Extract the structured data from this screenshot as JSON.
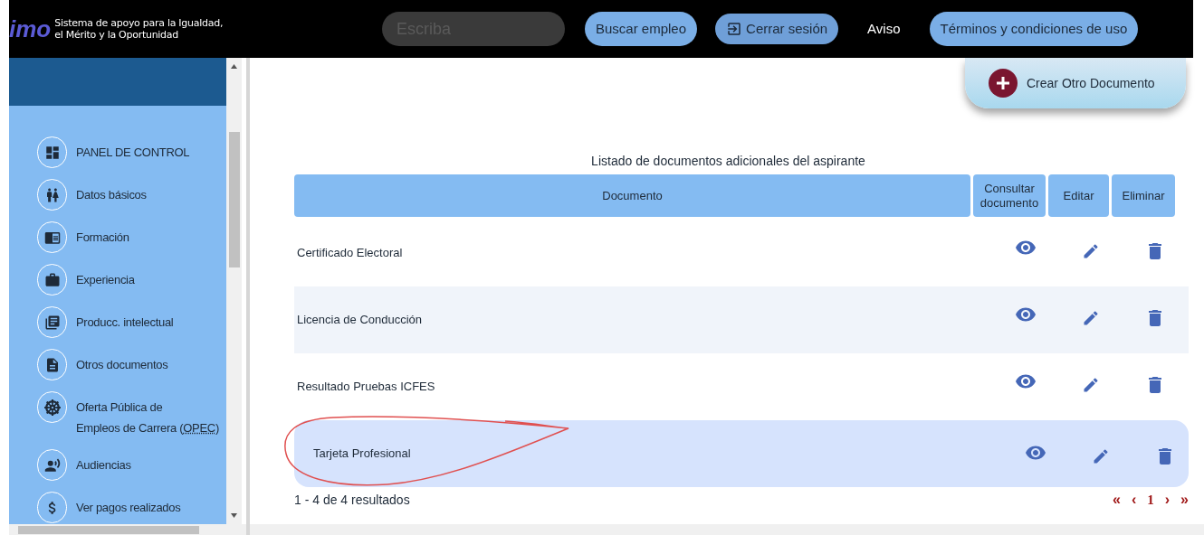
{
  "header": {
    "logo_text": "imo",
    "tagline_1": "Sistema de apoyo para la Igualdad,",
    "tagline_2": "el Mérito y la Oportunidad",
    "search": {
      "placeholder": "Escriba"
    },
    "buttons": [
      {
        "kind": "pill",
        "label": "Buscar empleo"
      },
      {
        "kind": "logout",
        "label": "Cerrar sesión"
      },
      {
        "kind": "link",
        "label": "Aviso"
      },
      {
        "kind": "pill",
        "label": "Términos y condiciones de uso"
      }
    ]
  },
  "sidebar": {
    "items": [
      {
        "label": "PANEL DE CONTROL"
      },
      {
        "label": "Datos básicos"
      },
      {
        "label": "Formación"
      },
      {
        "label": "Experiencia"
      },
      {
        "label": "Producc. intelectual"
      },
      {
        "label": "Otros documentos"
      },
      {
        "label": "Oferta Pública de",
        "label_2": "Empleos de Carrera (",
        "abbr": "OPEC",
        "label_end": ")"
      },
      {
        "label": "Audiencias"
      },
      {
        "label": "Ver pagos realizados"
      }
    ]
  },
  "create_button": {
    "label": "Crear Otro Documento"
  },
  "table": {
    "title": "Listado de documentos adicionales del aspirante",
    "columns": [
      "Documento",
      "Consultar documento",
      "Editar",
      "Eliminar"
    ],
    "rows": [
      {
        "document": "Certificado Electoral",
        "selected": false
      },
      {
        "document": "Licencia de Conducción",
        "selected": false
      },
      {
        "document": "Resultado Pruebas ICFES",
        "selected": false
      },
      {
        "document": "Tarjeta Profesional",
        "selected": true
      }
    ]
  },
  "pagination": {
    "summary": "1 - 4 de 4 resultados",
    "first": "«",
    "prev": "‹",
    "page": "1",
    "next": "›",
    "last": "»"
  }
}
